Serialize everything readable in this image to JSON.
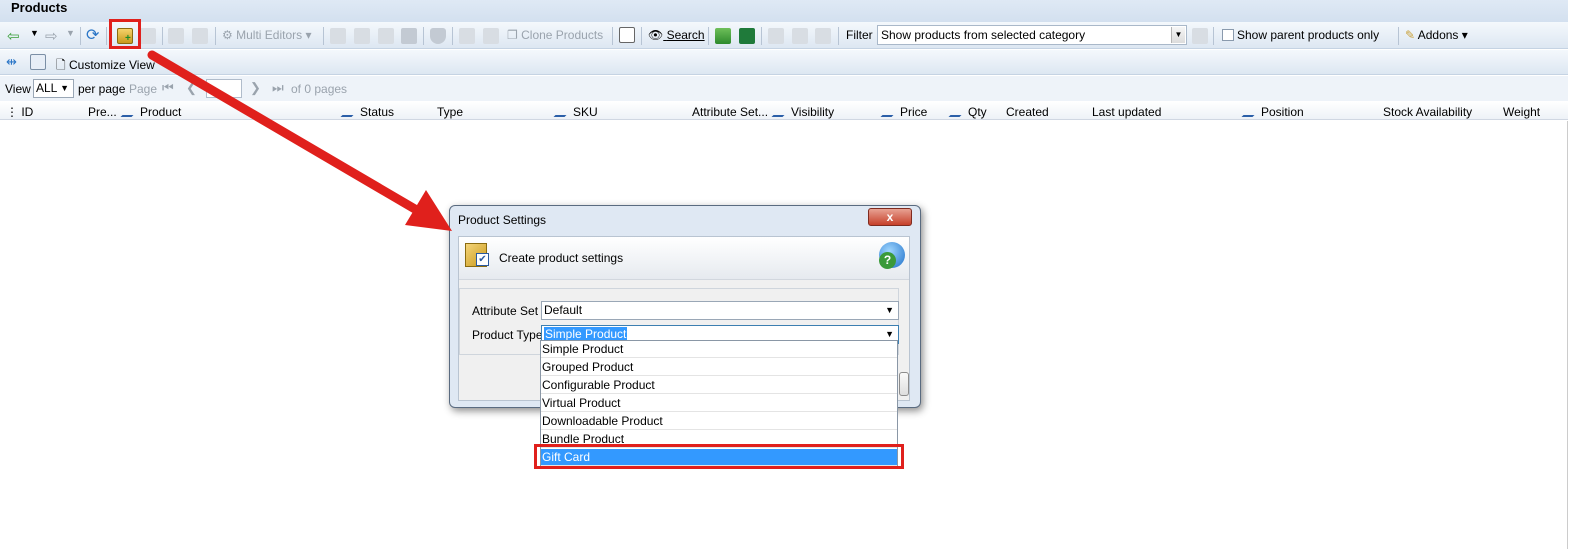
{
  "window": {
    "title": "Products"
  },
  "toolbar": {
    "multi_editors": "Multi Editors",
    "clone_products": "Clone Products",
    "search": "Search",
    "filter_label": "Filter",
    "filter_value": "Show products from selected category",
    "show_parent": "Show parent products only",
    "addons": "Addons"
  },
  "toolbar2": {
    "customize_view": "Customize View"
  },
  "pager": {
    "view_label": "View",
    "per_page_value": "ALL",
    "per_page_label": "per page",
    "page_label": "Page",
    "of_pages": "of 0 pages"
  },
  "columns": [
    "ID",
    "Pre...",
    "Product",
    "Status",
    "Type",
    "SKU",
    "Attribute Set...",
    "Visibility",
    "Price",
    "Qty",
    "Created",
    "Last updated",
    "Position",
    "Stock Availability",
    "Weight"
  ],
  "dialog": {
    "title": "Product Settings",
    "close": "x",
    "header": "Create product settings",
    "attribute_set_label": "Attribute Set",
    "attribute_set_value": "Default",
    "product_type_label": "Product Type",
    "product_type_value": "Simple Product",
    "options": [
      "Simple Product",
      "Grouped Product",
      "Configurable Product",
      "Virtual Product",
      "Downloadable Product",
      "Bundle Product",
      "Gift Card"
    ],
    "highlighted_option": "Gift Card"
  },
  "colors": {
    "annotation": "#e0201c",
    "selection": "#3399ff"
  }
}
